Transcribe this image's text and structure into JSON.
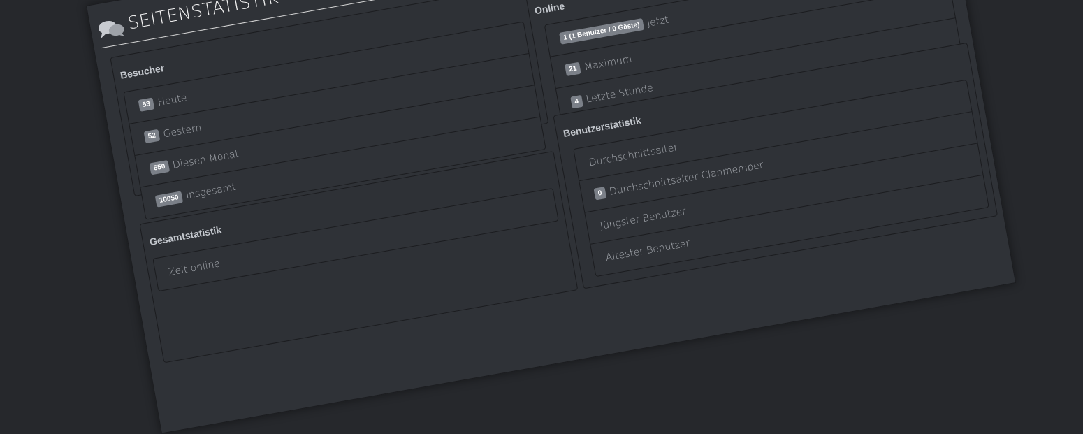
{
  "header": {
    "title": "SEITENSTATISTIK",
    "icon": "comments-icon"
  },
  "besucher": {
    "title": "Besucher",
    "items": [
      {
        "badge": "53",
        "label": "Heute"
      },
      {
        "badge": "52",
        "label": "Gestern"
      },
      {
        "badge": "650",
        "label": "Diesen Monat"
      },
      {
        "badge": "10050",
        "label": "Insgesamt"
      }
    ]
  },
  "gesamt": {
    "title": "Gesamtstatistik",
    "items": [
      {
        "badge": "",
        "label": "Zeit online"
      }
    ]
  },
  "online": {
    "title": "Online",
    "items": [
      {
        "badge": "1 (1 Benutzer / 0 Gäste)",
        "label": "Jetzt"
      },
      {
        "badge": "21",
        "label": "Maximum"
      },
      {
        "badge": "4",
        "label": "Letzte Stunde"
      }
    ]
  },
  "benutzer": {
    "title": "Benutzerstatistik",
    "items": [
      {
        "badge": "",
        "label": "Durchschnittsalter"
      },
      {
        "badge": "0",
        "label": "Durchschnittsalter Clanmember"
      },
      {
        "badge": "",
        "label": "Jüngster Benutzer"
      },
      {
        "badge": "",
        "label": "Ältester Benutzer"
      }
    ]
  }
}
